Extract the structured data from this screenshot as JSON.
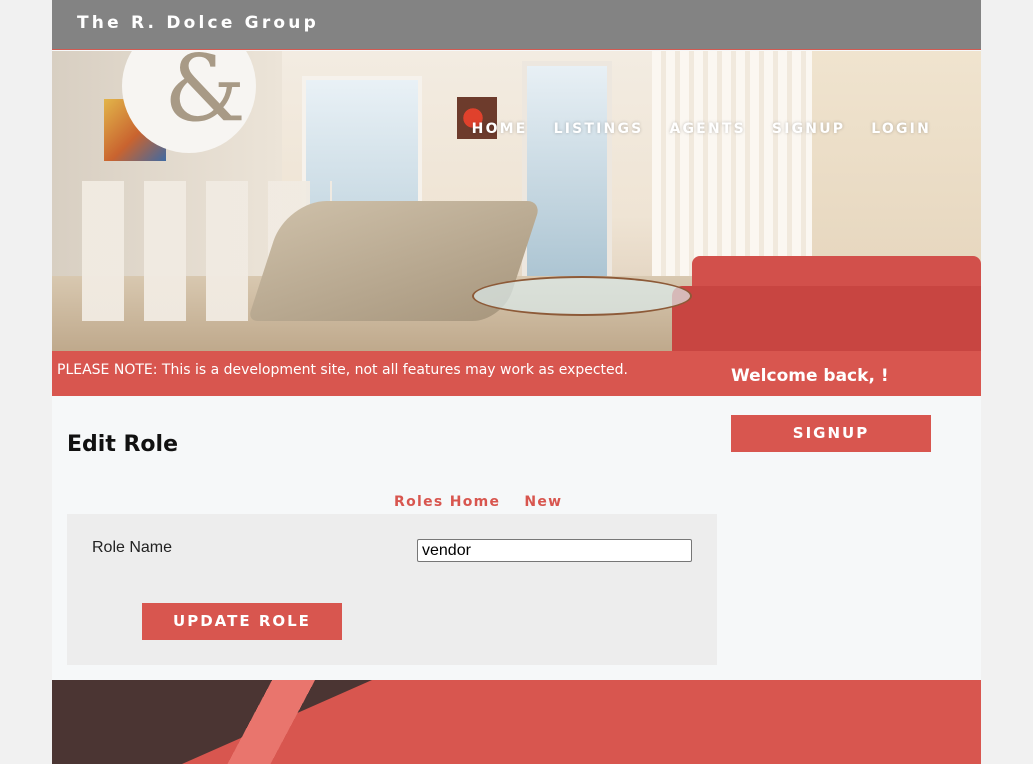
{
  "header": {
    "brand": "The R. Dolce Group"
  },
  "nav": {
    "items": [
      {
        "label": "HOME"
      },
      {
        "label": "LISTINGS"
      },
      {
        "label": "AGENTS"
      },
      {
        "label": "SIGNUP"
      },
      {
        "label": "LOGIN"
      }
    ]
  },
  "notice": {
    "text": "PLEASE NOTE: This is a development site, not all features may work as expected.",
    "welcome": "Welcome back, !"
  },
  "main": {
    "title": "Edit Role",
    "subnav": [
      {
        "label": "Roles Home"
      },
      {
        "label": "New"
      }
    ],
    "form": {
      "role_name_label": "Role Name",
      "role_name_value": "vendor",
      "submit_label": "UPDATE ROLE"
    }
  },
  "sidebar": {
    "signup_label": "SIGNUP"
  },
  "colors": {
    "accent": "#d8564f",
    "topbar": "#838383",
    "footer_dark": "#4b3533"
  }
}
